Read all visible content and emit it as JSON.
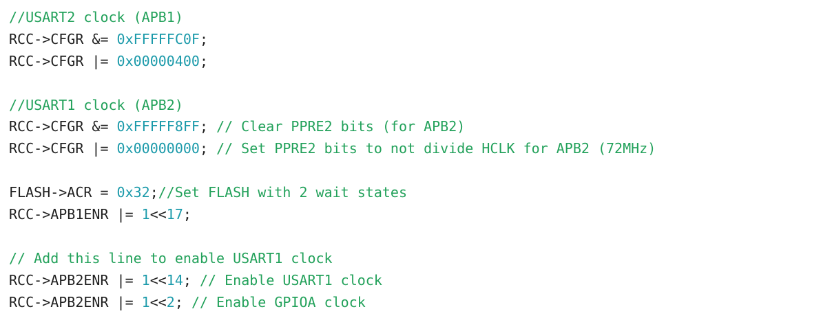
{
  "colors": {
    "plain": "#1f1f1f",
    "comment": "#22a15a",
    "number": "#1b9aaa",
    "background": "#ffffff"
  },
  "code": {
    "lines": [
      {
        "tokens": [
          {
            "type": "comment",
            "text": "//USART2 clock (APB1)"
          }
        ]
      },
      {
        "tokens": [
          {
            "type": "plain",
            "text": "RCC->CFGR &= "
          },
          {
            "type": "number",
            "text": "0xFFFFFC0F"
          },
          {
            "type": "plain",
            "text": ";"
          }
        ]
      },
      {
        "tokens": [
          {
            "type": "plain",
            "text": "RCC->CFGR |= "
          },
          {
            "type": "number",
            "text": "0x00000400"
          },
          {
            "type": "plain",
            "text": ";"
          }
        ]
      },
      {
        "tokens": []
      },
      {
        "tokens": [
          {
            "type": "comment",
            "text": "//USART1 clock (APB2)"
          }
        ]
      },
      {
        "tokens": [
          {
            "type": "plain",
            "text": "RCC->CFGR &= "
          },
          {
            "type": "number",
            "text": "0xFFFFF8FF"
          },
          {
            "type": "plain",
            "text": "; "
          },
          {
            "type": "comment",
            "text": "// Clear PPRE2 bits (for APB2)"
          }
        ]
      },
      {
        "tokens": [
          {
            "type": "plain",
            "text": "RCC->CFGR |= "
          },
          {
            "type": "number",
            "text": "0x00000000"
          },
          {
            "type": "plain",
            "text": "; "
          },
          {
            "type": "comment",
            "text": "// Set PPRE2 bits to not divide HCLK for APB2 (72MHz)"
          }
        ]
      },
      {
        "tokens": []
      },
      {
        "tokens": [
          {
            "type": "plain",
            "text": "FLASH->ACR = "
          },
          {
            "type": "number",
            "text": "0x32"
          },
          {
            "type": "plain",
            "text": ";"
          },
          {
            "type": "comment",
            "text": "//Set FLASH with 2 wait states"
          }
        ]
      },
      {
        "tokens": [
          {
            "type": "plain",
            "text": "RCC->APB1ENR |= "
          },
          {
            "type": "number",
            "text": "1"
          },
          {
            "type": "plain",
            "text": "<<"
          },
          {
            "type": "number",
            "text": "17"
          },
          {
            "type": "plain",
            "text": ";"
          }
        ]
      },
      {
        "tokens": []
      },
      {
        "tokens": [
          {
            "type": "comment",
            "text": "// Add this line to enable USART1 clock"
          }
        ]
      },
      {
        "tokens": [
          {
            "type": "plain",
            "text": "RCC->APB2ENR |= "
          },
          {
            "type": "number",
            "text": "1"
          },
          {
            "type": "plain",
            "text": "<<"
          },
          {
            "type": "number",
            "text": "14"
          },
          {
            "type": "plain",
            "text": "; "
          },
          {
            "type": "comment",
            "text": "// Enable USART1 clock"
          }
        ]
      },
      {
        "tokens": [
          {
            "type": "plain",
            "text": "RCC->APB2ENR |= "
          },
          {
            "type": "number",
            "text": "1"
          },
          {
            "type": "plain",
            "text": "<<"
          },
          {
            "type": "number",
            "text": "2"
          },
          {
            "type": "plain",
            "text": "; "
          },
          {
            "type": "comment",
            "text": "// Enable GPIOA clock"
          }
        ]
      }
    ]
  }
}
